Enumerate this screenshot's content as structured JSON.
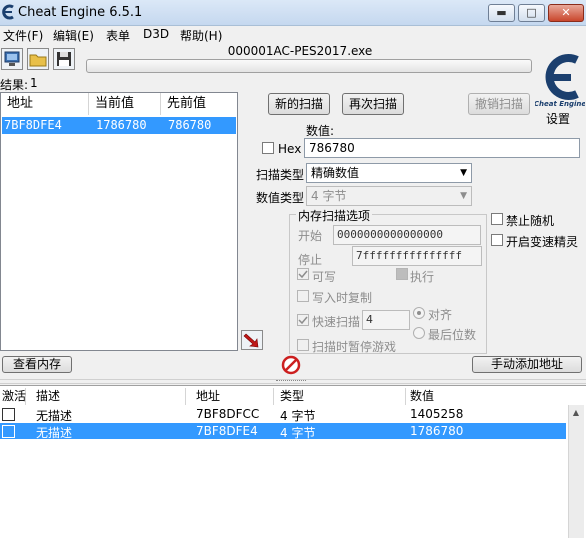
{
  "window": {
    "title": "Cheat Engine 6.5.1",
    "minimize": "▬",
    "maximize": "□",
    "close": "✕"
  },
  "menu": [
    "文件(F)",
    "编辑(E)",
    "表单",
    "D3D",
    "帮助(H)"
  ],
  "toolbar": {
    "process_name": "000001AC-PES2017.exe",
    "settings_label": "设置",
    "logo_text": "Cheat Engine"
  },
  "results": {
    "label": "结果:",
    "count": "1",
    "columns": [
      "地址",
      "当前值",
      "先前值"
    ],
    "rows": [
      {
        "address": "7BF8DFE4",
        "current": "1786780",
        "previous": "786780"
      }
    ]
  },
  "scan": {
    "new_scan": "新的扫描",
    "next_scan": "再次扫描",
    "undo_scan": "撤销扫描",
    "value_label": "数值:",
    "hex_label": "Hex",
    "value": "786780",
    "scan_type_label": "扫描类型",
    "scan_type": "精确数值",
    "value_type_label": "数值类型",
    "value_type": "4 字节"
  },
  "memory_options": {
    "title": "内存扫描选项",
    "start_label": "开始",
    "start_value": "0000000000000000",
    "stop_label": "停止",
    "stop_value": "7fffffffffffffff",
    "writable": "可写",
    "executable": "执行",
    "copy_on_write": "写入时复制",
    "fast_scan": "快速扫描",
    "fast_scan_value": "4",
    "alignment": "对齐",
    "last_digits": "最后位数",
    "pause_game": "扫描时暂停游戏"
  },
  "extra_options": {
    "no_random": "禁止随机",
    "speedhack": "开启变速精灵"
  },
  "bottom_buttons": {
    "view_memory": "查看内存",
    "add_address": "手动添加地址"
  },
  "address_list": {
    "columns": [
      "激活",
      "描述",
      "地址",
      "类型",
      "数值"
    ],
    "rows": [
      {
        "description": "无描述",
        "address": "7BF8DFCC",
        "type": "4 字节",
        "value": "1405258"
      },
      {
        "description": "无描述",
        "address": "7BF8DFE4",
        "type": "4 字节",
        "value": "1786780"
      }
    ]
  },
  "colors": {
    "selection": "#3399ff",
    "background": "#f0f0f0",
    "stop_red": "#cc1f1f"
  }
}
